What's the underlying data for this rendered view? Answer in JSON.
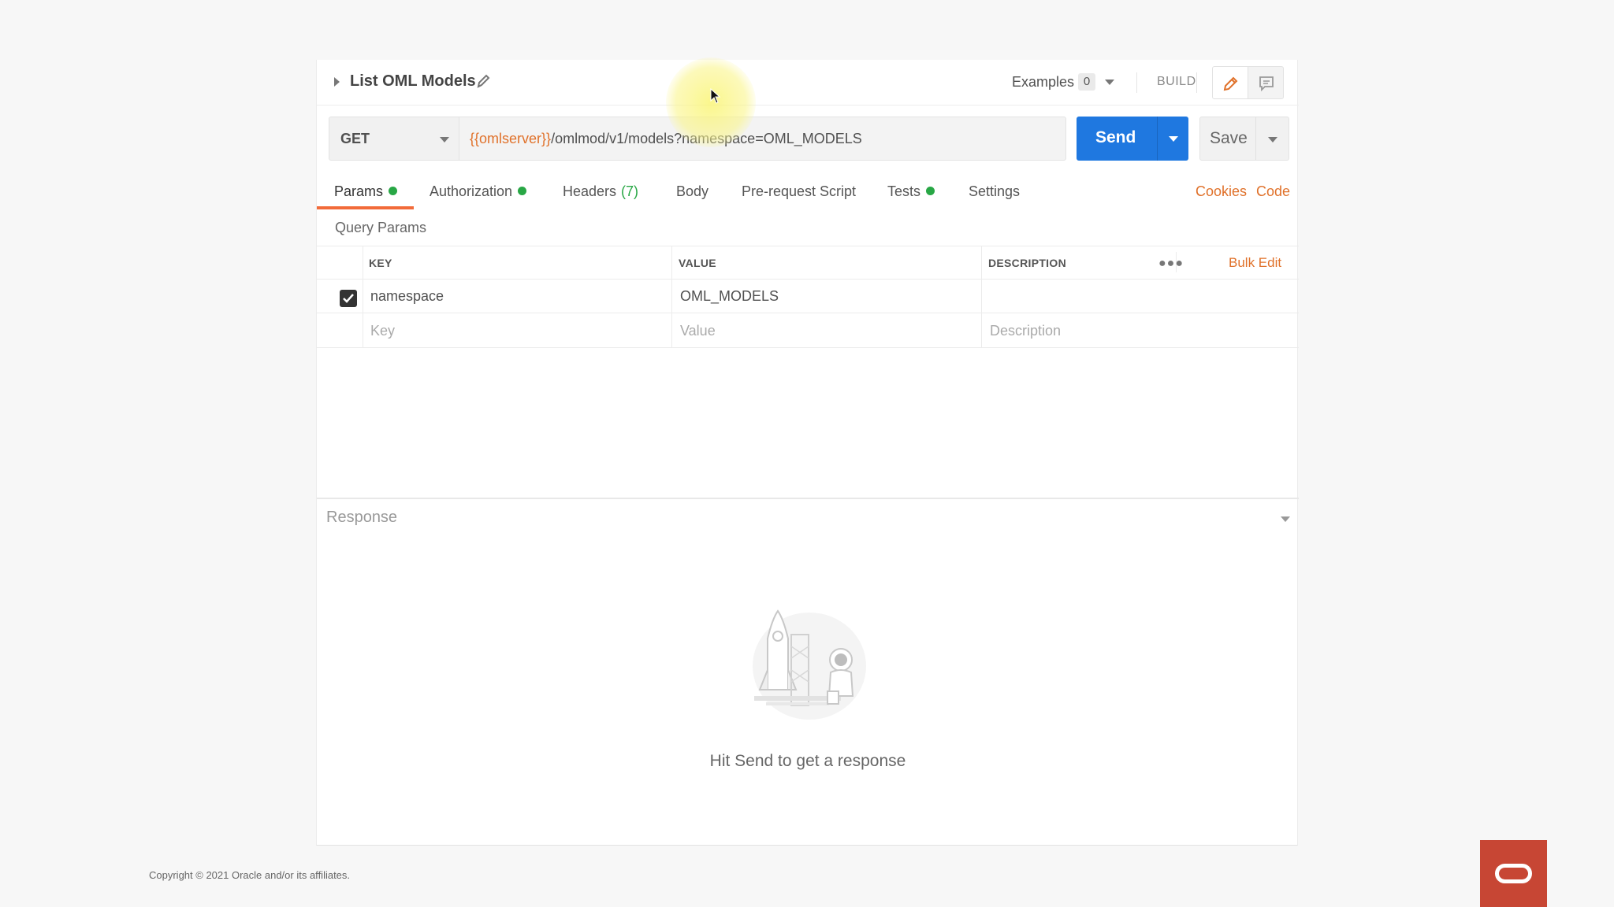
{
  "request": {
    "name": "List OML Models",
    "examples_label": "Examples",
    "examples_count": "0",
    "build_label": "BUILD"
  },
  "url_bar": {
    "method": "GET",
    "url_variable": "{{omlserver}}",
    "url_path": "/omlmod/v1/models?namespace=OML_MODELS",
    "send_label": "Send",
    "save_label": "Save"
  },
  "tabs": [
    {
      "label": "Params",
      "dot": true
    },
    {
      "label": "Authorization",
      "dot": true
    },
    {
      "label": "Headers",
      "count": "(7)"
    },
    {
      "label": "Body"
    },
    {
      "label": "Pre-request Script"
    },
    {
      "label": "Tests",
      "dot": true
    },
    {
      "label": "Settings"
    }
  ],
  "tab_links": {
    "cookies": "Cookies",
    "code": "Code"
  },
  "query_params": {
    "title": "Query Params",
    "headers": {
      "key": "KEY",
      "value": "VALUE",
      "description": "DESCRIPTION"
    },
    "bulk_edit": "Bulk Edit",
    "rows": [
      {
        "checked": true,
        "key": "namespace",
        "value": "OML_MODELS",
        "description": ""
      }
    ],
    "placeholders": {
      "key": "Key",
      "value": "Value",
      "description": "Description"
    }
  },
  "response": {
    "title": "Response",
    "empty_message": "Hit Send to get a response"
  },
  "footer": {
    "copyright": "Copyright © 2021 Oracle and/or its affiliates."
  },
  "colors": {
    "accent": "#f26b3a",
    "send": "#1f78e0",
    "status_dot": "#28a745",
    "oracle": "#c74634"
  }
}
